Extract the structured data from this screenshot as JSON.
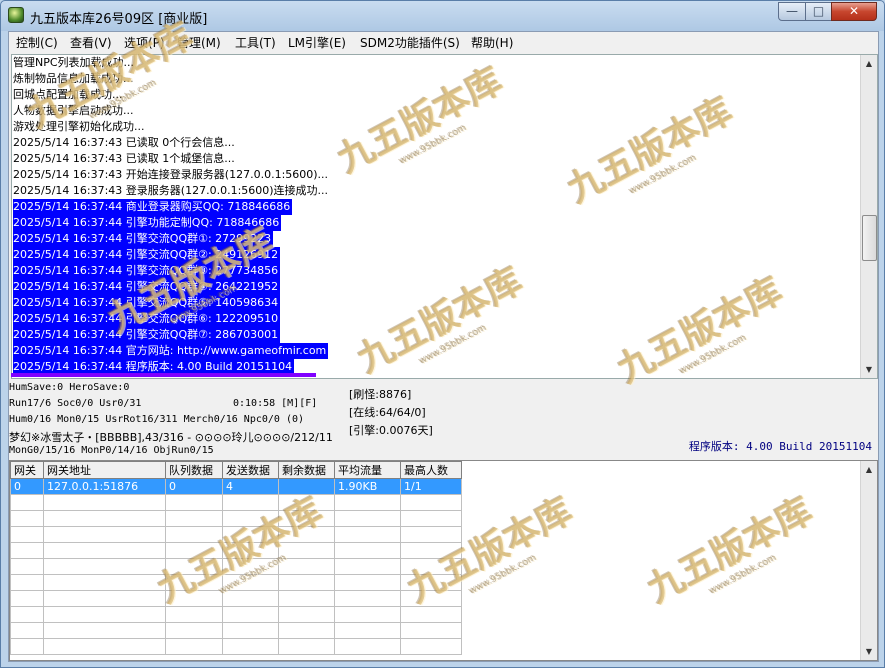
{
  "window": {
    "title": "九五版本库26号09区 [商业版]",
    "controls": {
      "minimize": "—",
      "maximize": "□",
      "close": "✕"
    }
  },
  "menu": [
    "控制(C)",
    "查看(V)",
    "选项(P)",
    "管理(M)",
    "工具(T)",
    "LM引擎(E)",
    "SDM2功能插件(S)",
    "帮助(H)"
  ],
  "log": [
    {
      "text": "管理NPC列表加载成功...",
      "highlight": false
    },
    {
      "text": "炼制物品信息加载成功...",
      "highlight": false
    },
    {
      "text": "回城点配置加载成功...",
      "highlight": false
    },
    {
      "text": "人物数据引擎启动成功...",
      "highlight": false
    },
    {
      "text": "游戏处理引擎初始化成功...",
      "highlight": false
    },
    {
      "text": "2025/5/14 16:37:43 已读取 0个行会信息...",
      "highlight": false
    },
    {
      "text": "2025/5/14 16:37:43 已读取 1个城堡信息...",
      "highlight": false
    },
    {
      "text": "2025/5/14 16:37:43 开始连接登录服务器(127.0.0.1:5600)...",
      "highlight": false
    },
    {
      "text": "2025/5/14 16:37:43 登录服务器(127.0.0.1:5600)连接成功...",
      "highlight": false
    },
    {
      "text": "2025/5/14 16:37:44 商业登录器购买QQ: 718846686",
      "highlight": true
    },
    {
      "text": "2025/5/14 16:37:44 引擎功能定制QQ: 718846686",
      "highlight": true
    },
    {
      "text": "2025/5/14 16:37:44 引擎交流QQ群①: 27299223",
      "highlight": true
    },
    {
      "text": "2025/5/14 16:37:44 引擎交流QQ群②: 249126912",
      "highlight": true
    },
    {
      "text": "2025/5/14 16:37:44 引擎交流QQ群③: 277734856",
      "highlight": true
    },
    {
      "text": "2025/5/14 16:37:44 引擎交流QQ群④: 264221952",
      "highlight": true
    },
    {
      "text": "2025/5/14 16:37:44 引擎交流QQ群⑤: 140598634",
      "highlight": true
    },
    {
      "text": "2025/5/14 16:37:44 引擎交流QQ群⑥: 122209510",
      "highlight": true
    },
    {
      "text": "2025/5/14 16:37:44 引擎交流QQ群⑦: 286703001",
      "highlight": true
    },
    {
      "text": "2025/5/14 16:37:44 官方网站: http://www.gameofmir.com",
      "highlight": true
    },
    {
      "text": "2025/5/14 16:37:44 程序版本: 4.00 Build 20151104",
      "highlight": true
    }
  ],
  "stats": {
    "hum_save": "HumSave:0 HeroSave:0",
    "run": "Run17/6 Soc0/0 Usr0/31",
    "uptime": "0:10:58 [M][F]",
    "hum": "Hum0/16 Mon0/15 UsrRot16/311 Merch0/16 Npc0/0 (0)",
    "player": "梦幻※冰雪太子・[BBBBB],43/316 - ⊙⊙⊙⊙玲儿⊙⊙⊙⊙/212/11",
    "mon": "MonG0/15/16 MonP0/14/16 ObjRun0/15",
    "refresh_monster": "[刷怪:8876]",
    "online": "[在线:64/64/0]",
    "engine": "[引擎:0.0076天]",
    "version": "程序版本: 4.00 Build 20151104"
  },
  "gateway_table": {
    "headers": [
      "网关",
      "网关地址",
      "队列数据",
      "发送数据",
      "剩余数据",
      "平均流量",
      "最高人数"
    ],
    "rows": [
      [
        "0",
        "127.0.0.1:51876",
        "0",
        "4",
        "",
        "1.90KB",
        "1/1"
      ]
    ]
  },
  "watermark": {
    "text": "九五版本库",
    "subtext": "www.95bbk.com"
  }
}
